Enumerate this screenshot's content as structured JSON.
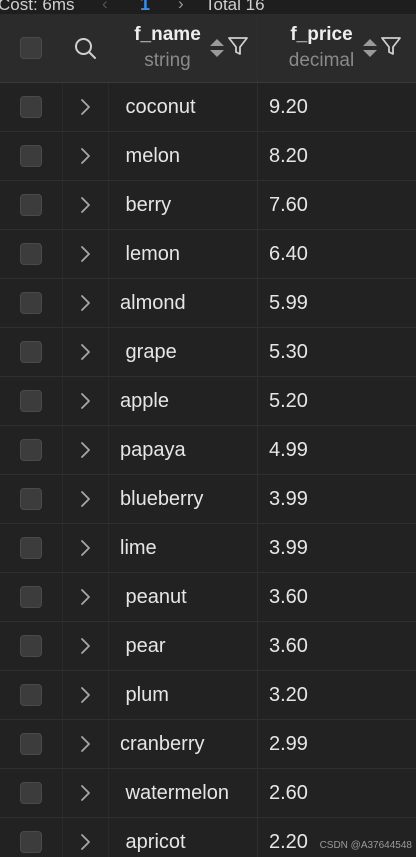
{
  "status": {
    "cost": "Cost: 6ms",
    "page": "1",
    "total": "Total 16"
  },
  "columns": [
    {
      "name": "f_name",
      "type": "string"
    },
    {
      "name": "f_price",
      "type": "decimal"
    }
  ],
  "rows": [
    {
      "name": " coconut",
      "price": "9.20"
    },
    {
      "name": " melon",
      "price": "8.20"
    },
    {
      "name": " berry",
      "price": "7.60"
    },
    {
      "name": " lemon",
      "price": "6.40"
    },
    {
      "name": "almond",
      "price": "5.99"
    },
    {
      "name": " grape",
      "price": "5.30"
    },
    {
      "name": "apple",
      "price": "5.20"
    },
    {
      "name": "papaya",
      "price": "4.99"
    },
    {
      "name": "blueberry",
      "price": "3.99"
    },
    {
      "name": "lime",
      "price": "3.99"
    },
    {
      "name": " peanut",
      "price": "3.60"
    },
    {
      "name": " pear",
      "price": "3.60"
    },
    {
      "name": " plum",
      "price": "3.20"
    },
    {
      "name": "cranberry",
      "price": "2.99"
    },
    {
      "name": " watermelon",
      "price": "2.60"
    },
    {
      "name": " apricot",
      "price": "2.20"
    }
  ],
  "icons": {
    "search": "search-icon",
    "sort": "sort-icon",
    "filter": "filter-icon",
    "expand": "chevron-right-icon",
    "prev": "chevron-left-icon",
    "next": "chevron-right-icon"
  },
  "colors": {
    "accent": "#3a8ee6",
    "background": "#1e1e1e"
  },
  "watermark": "CSDN @A37644548"
}
